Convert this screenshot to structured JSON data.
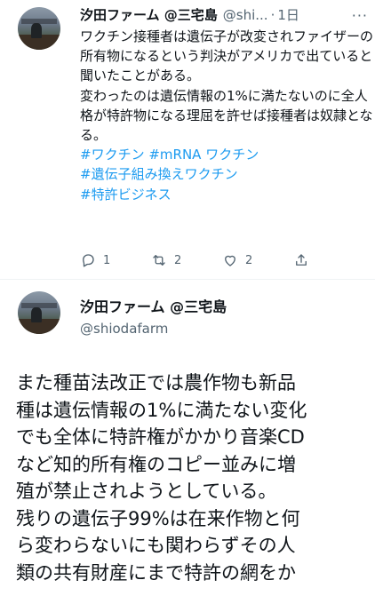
{
  "tweet1": {
    "author_name": "汐田ファーム @三宅島",
    "handle": "@shi...",
    "separator": "·",
    "timestamp": "1日",
    "more_label": "···",
    "text": "ワクチン接種者は遺伝子が改変されファイザーの所有物になるという判決がアメリカで出ていると聞いたことがある。\n変わったのは遺伝情報の1%に満たないのに全人格が特許物になる理屈を許せば接種者は奴隷となる。",
    "hashtags": [
      "#ワクチン #mRNA ワクチン",
      "#遺伝子組み換えワクチン",
      "#特許ビジネス"
    ],
    "actions": {
      "reply_count": "1",
      "retweet_count": "2",
      "like_count": "2"
    },
    "icons": [
      "reply-icon",
      "retweet-icon",
      "like-icon",
      "share-icon"
    ]
  },
  "tweet2": {
    "author_name": "汐田ファーム @三宅島",
    "handle": "@shiodafarm",
    "text": "また種苗法改正では農作物も新品\n種は遺伝情報の1%に満たない変化\nでも全体に特許権がかかり音楽CD\nなど知的所有権のコピー並みに増\n殖が禁止されようとしている。\n残りの遺伝子99%は在来作物と何\nら変わらないにも関わらずその人\n類の共有財産にまで特許の網をか"
  },
  "colors": {
    "text": "#0f1419",
    "muted": "#536471",
    "link": "#1d9bf0",
    "divider": "#eff3f4"
  }
}
